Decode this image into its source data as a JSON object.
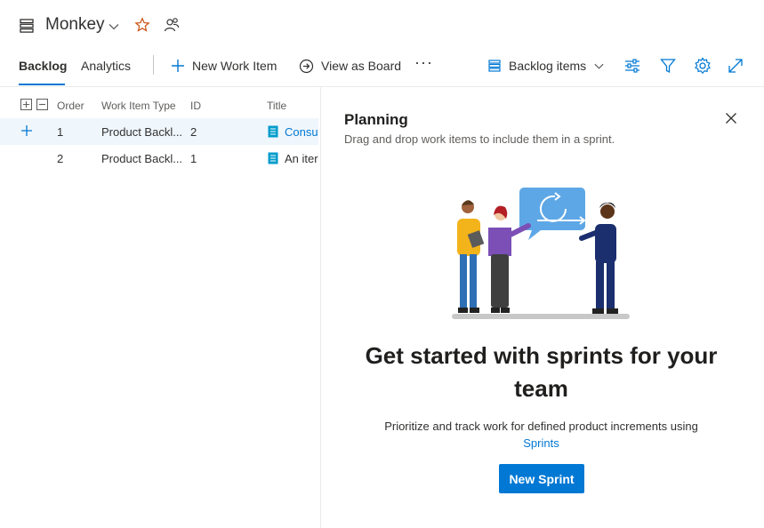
{
  "header": {
    "team_name": "Monkey",
    "icons": {
      "backlog": "backlog-icon",
      "chevron": "chevron-down-icon",
      "favorite": "star-icon",
      "team": "people-icon"
    }
  },
  "tabs": [
    {
      "label": "Backlog",
      "active": true
    },
    {
      "label": "Analytics",
      "active": false
    }
  ],
  "toolbar": {
    "new_item_label": "New Work Item",
    "view_board_label": "View as Board",
    "more_label": "···",
    "backlog_level_label": "Backlog items"
  },
  "grid": {
    "columns": [
      "Order",
      "Work Item Type",
      "ID",
      "Title"
    ],
    "rows": [
      {
        "order": "1",
        "type": "Product Backl...",
        "id": "2",
        "title": "Consu",
        "selected": true
      },
      {
        "order": "2",
        "type": "Product Backl...",
        "id": "1",
        "title": "An iter",
        "selected": false
      }
    ]
  },
  "panel": {
    "title": "Planning",
    "subtitle": "Drag and drop work items to include them in a sprint.",
    "heading": "Get started with sprints for your team",
    "description": "Prioritize and track work for defined product increments using",
    "link_text": "Sprints",
    "button_label": "New Sprint"
  },
  "colors": {
    "accent": "#0078d4",
    "selected_row": "#eff6fc",
    "star": "#ca5010"
  }
}
